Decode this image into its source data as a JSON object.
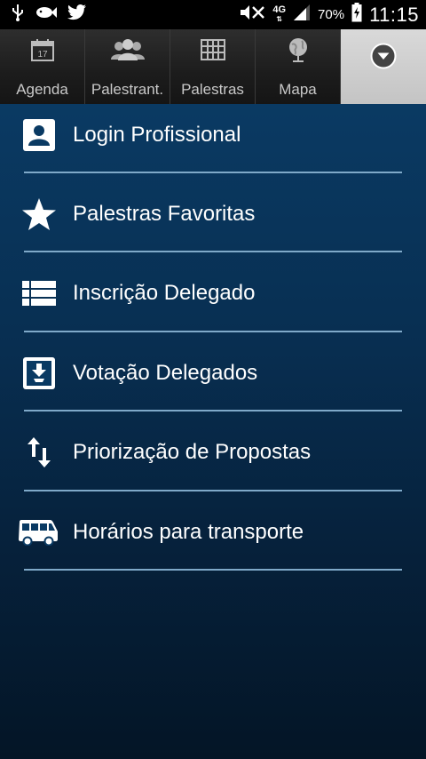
{
  "status_bar": {
    "left_icons": [
      "usb-icon",
      "fish-icon",
      "twitter-icon"
    ],
    "network_type": "4G",
    "battery_percent": "70%",
    "time": "11:15"
  },
  "tabs": [
    {
      "label": "Agenda",
      "icon": "calendar-icon",
      "calendar_day": "17"
    },
    {
      "label": "Palestrant.",
      "icon": "people-icon"
    },
    {
      "label": "Palestras",
      "icon": "grid-icon"
    },
    {
      "label": "Mapa",
      "icon": "globe-icon"
    },
    {
      "label": "",
      "icon": "menu-dropdown-icon"
    }
  ],
  "menu": {
    "items": [
      {
        "label": "Login Profissional",
        "icon": "account-box-icon"
      },
      {
        "label": "Palestras Favoritas",
        "icon": "star-icon"
      },
      {
        "label": "Inscrição Delegado",
        "icon": "list-icon"
      },
      {
        "label": "Votação Delegados",
        "icon": "inbox-download-icon"
      },
      {
        "label": "Priorização de Propostas",
        "icon": "sort-arrows-icon"
      },
      {
        "label": "Horários para transporte",
        "icon": "bus-icon"
      }
    ]
  },
  "colors": {
    "panel_top": "#0a3a63",
    "panel_bottom": "#041526",
    "divider": "#7fa9c9",
    "active_tab": "#cfcfcf"
  }
}
